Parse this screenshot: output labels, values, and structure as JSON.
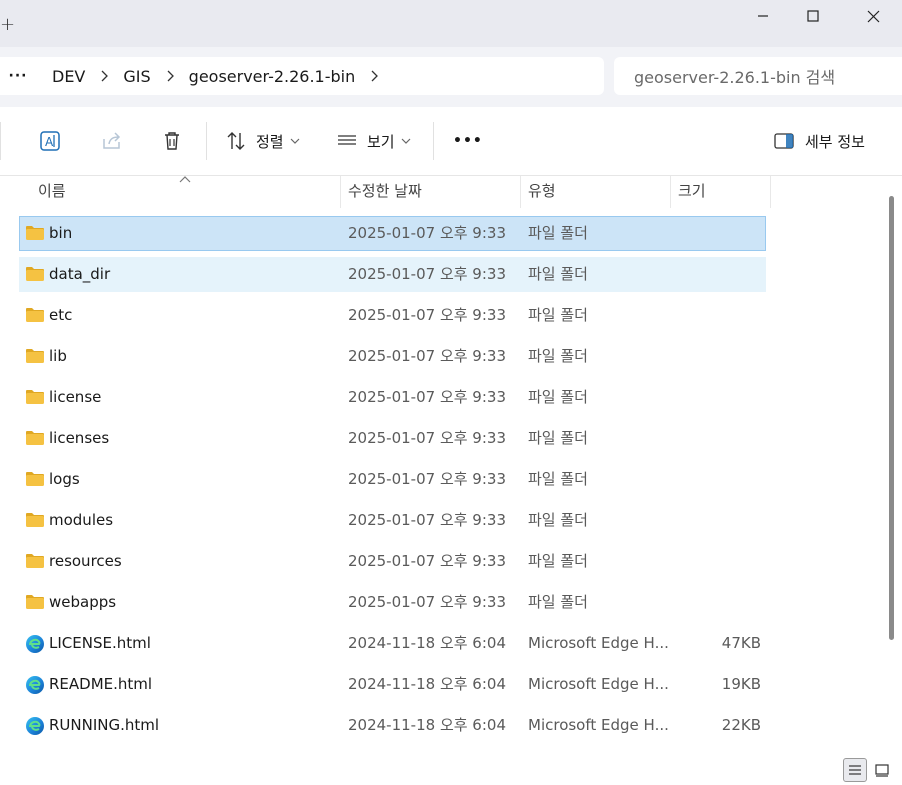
{
  "titlebar": {
    "new_tab": "+"
  },
  "address": {
    "overflow": "···",
    "crumbs": [
      "DEV",
      "GIS",
      "geoserver-2.26.1-bin"
    ]
  },
  "search": {
    "placeholder": "geoserver-2.26.1-bin 검색"
  },
  "toolbar": {
    "sort_label": "정렬",
    "view_label": "보기",
    "more_label": "•••",
    "details_label": "세부 정보"
  },
  "columns": {
    "name": "이름",
    "modified": "수정한 날짜",
    "type": "유형",
    "size": "크기"
  },
  "files": [
    {
      "name": "bin",
      "modified": "2025-01-07 오후 9:33",
      "type": "파일 폴더",
      "size": "",
      "icon": "folder-icon",
      "state": "selected"
    },
    {
      "name": "data_dir",
      "modified": "2025-01-07 오후 9:33",
      "type": "파일 폴더",
      "size": "",
      "icon": "folder-icon",
      "state": "hover"
    },
    {
      "name": "etc",
      "modified": "2025-01-07 오후 9:33",
      "type": "파일 폴더",
      "size": "",
      "icon": "folder-icon",
      "state": ""
    },
    {
      "name": "lib",
      "modified": "2025-01-07 오후 9:33",
      "type": "파일 폴더",
      "size": "",
      "icon": "folder-icon",
      "state": ""
    },
    {
      "name": "license",
      "modified": "2025-01-07 오후 9:33",
      "type": "파일 폴더",
      "size": "",
      "icon": "folder-icon",
      "state": ""
    },
    {
      "name": "licenses",
      "modified": "2025-01-07 오후 9:33",
      "type": "파일 폴더",
      "size": "",
      "icon": "folder-icon",
      "state": ""
    },
    {
      "name": "logs",
      "modified": "2025-01-07 오후 9:33",
      "type": "파일 폴더",
      "size": "",
      "icon": "folder-icon",
      "state": ""
    },
    {
      "name": "modules",
      "modified": "2025-01-07 오후 9:33",
      "type": "파일 폴더",
      "size": "",
      "icon": "folder-icon",
      "state": ""
    },
    {
      "name": "resources",
      "modified": "2025-01-07 오후 9:33",
      "type": "파일 폴더",
      "size": "",
      "icon": "folder-icon",
      "state": ""
    },
    {
      "name": "webapps",
      "modified": "2025-01-07 오후 9:33",
      "type": "파일 폴더",
      "size": "",
      "icon": "folder-icon",
      "state": ""
    },
    {
      "name": "LICENSE.html",
      "modified": "2024-11-18 오후 6:04",
      "type": "Microsoft Edge H...",
      "size": "47KB",
      "icon": "edge-icon",
      "state": ""
    },
    {
      "name": "README.html",
      "modified": "2024-11-18 오후 6:04",
      "type": "Microsoft Edge H...",
      "size": "19KB",
      "icon": "edge-icon",
      "state": ""
    },
    {
      "name": "RUNNING.html",
      "modified": "2024-11-18 오후 6:04",
      "type": "Microsoft Edge H...",
      "size": "22KB",
      "icon": "edge-icon",
      "state": ""
    }
  ],
  "colors": {
    "selected_bg": "#cce4f7",
    "hover_bg": "#e5f3fb",
    "folder": "#f5c242"
  }
}
